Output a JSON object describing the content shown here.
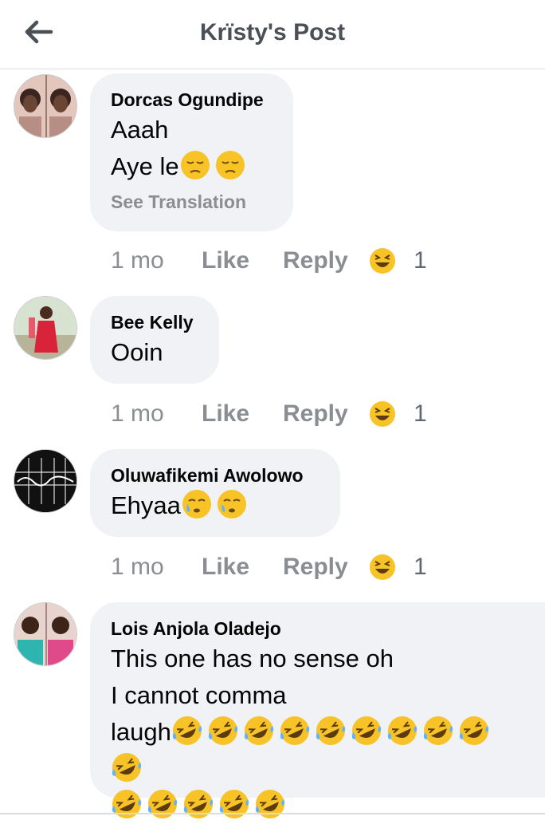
{
  "header": {
    "title": "Krïsty's Post"
  },
  "comments": [
    {
      "author": "Dorcas Ogundipe",
      "line1": "Aaah",
      "line2": "Aye le",
      "emoji_name": "pensive-emoji",
      "translate": "See Translation",
      "time": "1 mo",
      "like": "Like",
      "reply": "Reply",
      "reaction_count": "1"
    },
    {
      "author": "Bee Kelly",
      "line1": "Ooin",
      "time": "1 mo",
      "like": "Like",
      "reply": "Reply",
      "reaction_count": "1"
    },
    {
      "author": "Oluwafikemi Awolowo",
      "line1": "Ehyaa",
      "emoji_name": "sad-relieved-emoji",
      "time": "1 mo",
      "like": "Like",
      "reply": "Reply",
      "reaction_count": "1"
    },
    {
      "author": "Lois Anjola Oladejo",
      "line1": "This one has no sense oh",
      "line2": "I cannot comma",
      "line3": "laugh",
      "emoji_name": "rofl-emoji",
      "rofl_count": 15
    }
  ],
  "colors": {
    "bubble": "#f0f2f5",
    "meta": "#8a8d91",
    "emoji": "#f7c326"
  }
}
